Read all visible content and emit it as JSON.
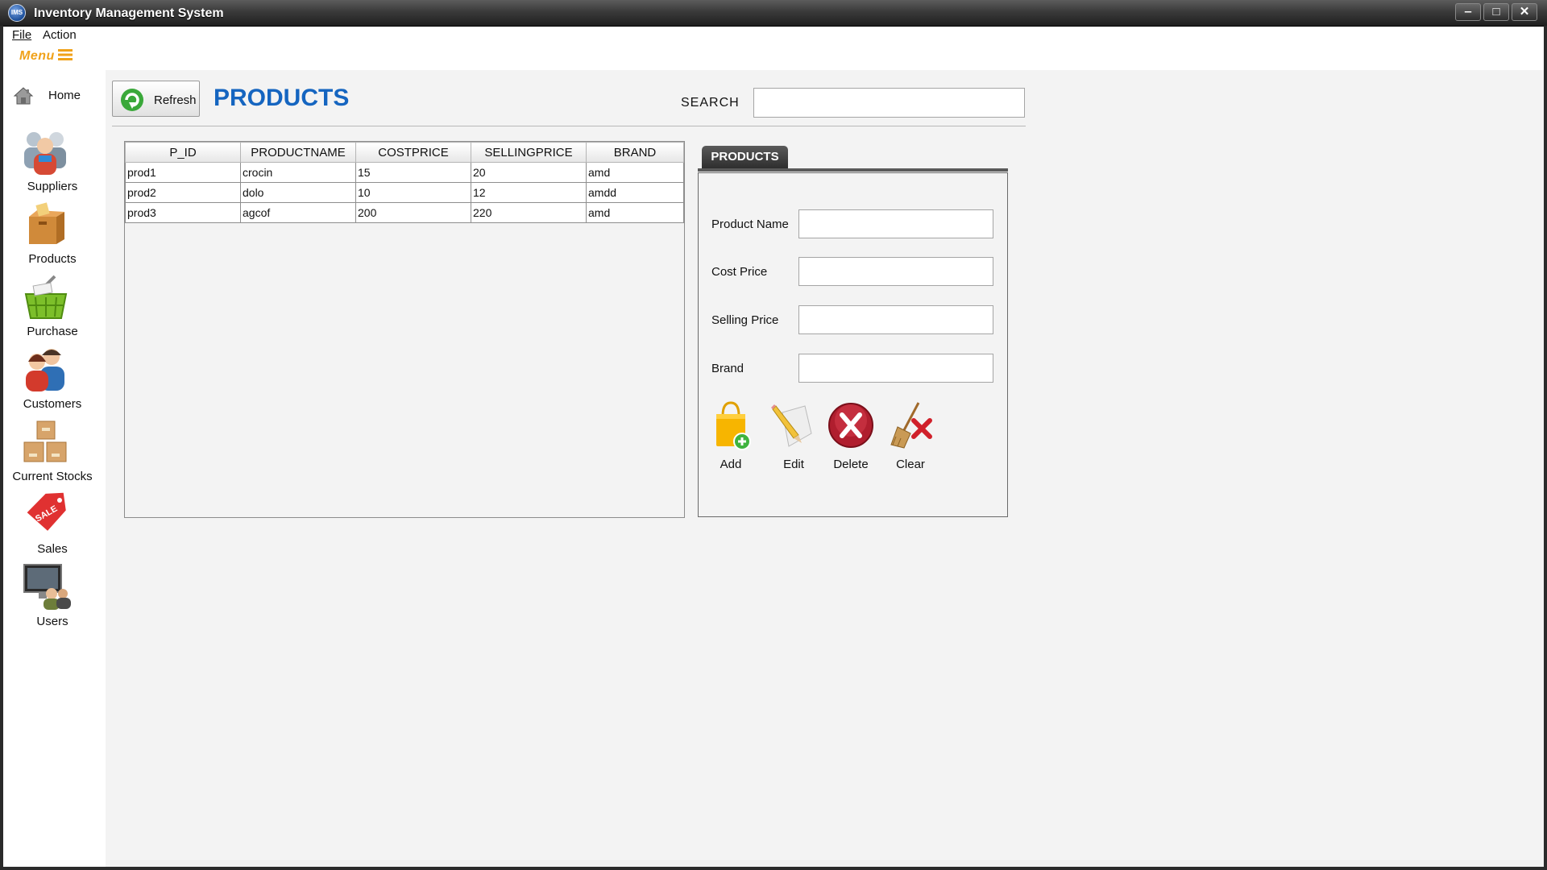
{
  "window": {
    "title": "Inventory Management System",
    "app_icon_text": "IMS",
    "minimize_glyph": "‒",
    "maximize_glyph": "□",
    "close_glyph": "✕"
  },
  "menubar": {
    "file": "File",
    "action": "Action",
    "menu_toggle": "Menu"
  },
  "sidebar": {
    "home": "Home",
    "items": [
      {
        "label": "Suppliers",
        "icon": "suppliers-icon"
      },
      {
        "label": "Products",
        "icon": "products-icon"
      },
      {
        "label": "Purchase",
        "icon": "purchase-icon"
      },
      {
        "label": "Customers",
        "icon": "customers-icon"
      },
      {
        "label": "Current Stocks",
        "icon": "stocks-icon"
      },
      {
        "label": "Sales",
        "icon": "sales-icon"
      },
      {
        "label": "Users",
        "icon": "users-icon"
      }
    ]
  },
  "toolbar": {
    "refresh_label": "Refresh",
    "page_title": "PRODUCTS",
    "search_label": "SEARCH",
    "search_value": ""
  },
  "table": {
    "columns": [
      "P_ID",
      "PRODUCTNAME",
      "COSTPRICE",
      "SELLINGPRICE",
      "BRAND"
    ],
    "rows": [
      [
        "prod1",
        "crocin",
        "15",
        "20",
        "amd"
      ],
      [
        "prod2",
        "dolo",
        "10",
        "12",
        "amdd"
      ],
      [
        "prod3",
        "agcof",
        "200",
        "220",
        "amd"
      ]
    ]
  },
  "form": {
    "tab_label": "PRODUCTS",
    "fields": [
      {
        "label": "Product Name",
        "value": ""
      },
      {
        "label": "Cost Price",
        "value": ""
      },
      {
        "label": "Selling Price",
        "value": ""
      },
      {
        "label": "Brand",
        "value": ""
      }
    ],
    "buttons": {
      "add": "Add",
      "edit": "Edit",
      "delete": "Delete",
      "clear": "Clear"
    }
  },
  "colors": {
    "title_blue": "#1565c0",
    "menu_orange": "#f0a21a",
    "titlebar_dark": "#2e2e2e"
  }
}
